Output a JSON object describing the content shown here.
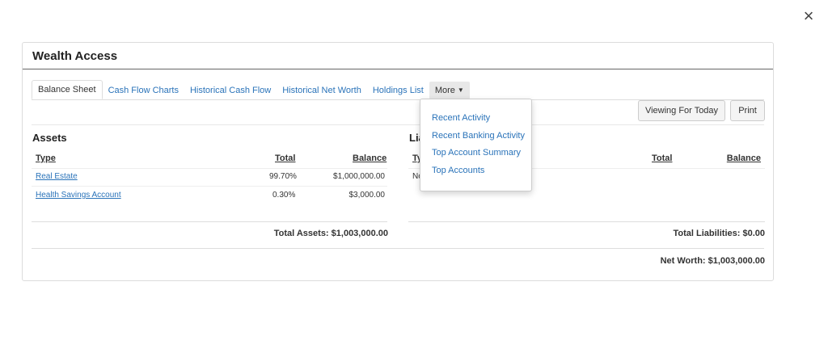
{
  "close_label": "×",
  "panel": {
    "title": "Wealth Access"
  },
  "tabs": [
    {
      "label": "Balance Sheet"
    },
    {
      "label": "Cash Flow Charts"
    },
    {
      "label": "Historical Cash Flow"
    },
    {
      "label": "Historical Net Worth"
    },
    {
      "label": "Holdings List"
    },
    {
      "label": "More"
    }
  ],
  "toolbar": {
    "viewing_label": "Viewing For Today",
    "print_label": "Print"
  },
  "assets": {
    "title": "Assets",
    "headers": {
      "type": "Type",
      "total": "Total",
      "balance": "Balance"
    },
    "rows": [
      {
        "type": "Real Estate",
        "total": "99.70%",
        "balance": "$1,000,000.00"
      },
      {
        "type": "Health Savings Account",
        "total": "0.30%",
        "balance": "$3,000.00"
      }
    ],
    "total_label": "Total Assets: $1,003,000.00"
  },
  "liabilities": {
    "title": "Lia",
    "headers": {
      "type": "Ty",
      "total": "Total",
      "balance": "Balance"
    },
    "rows": [
      {
        "type": "No"
      }
    ],
    "total_label": "Total Liabilities: $0.00"
  },
  "net_worth_label": "Net Worth: $1,003,000.00",
  "more_menu": {
    "items": [
      {
        "label": "Recent Activity"
      },
      {
        "label": "Recent Banking Activity"
      },
      {
        "label": "Top Account Summary"
      },
      {
        "label": "Top Accounts"
      }
    ]
  }
}
